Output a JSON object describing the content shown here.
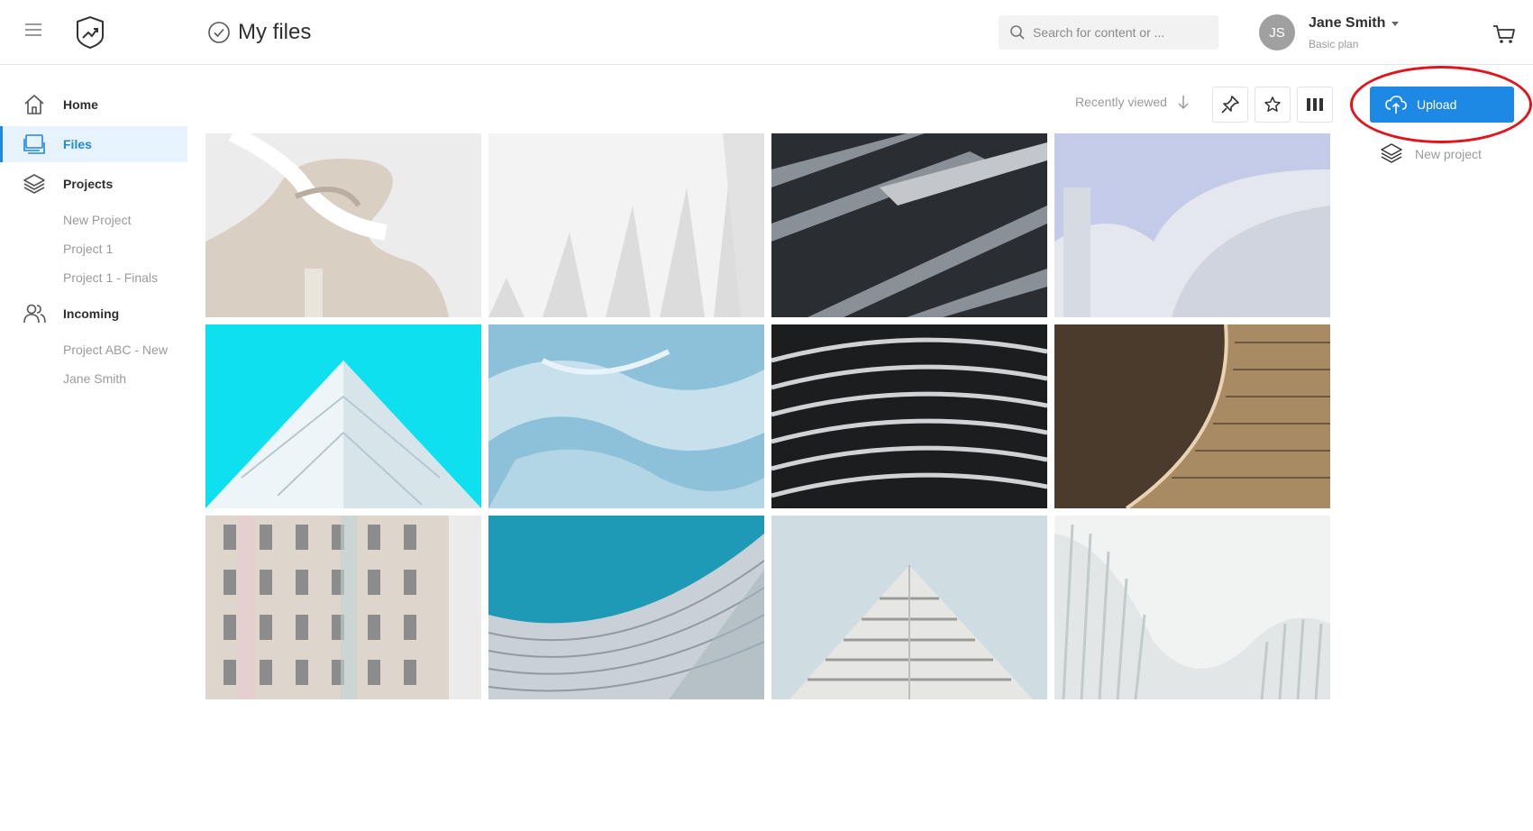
{
  "header": {
    "title": "My files",
    "search_placeholder": "Search for content or ...",
    "user": {
      "initials": "JS",
      "name": "Jane Smith",
      "plan": "Basic plan"
    }
  },
  "sidebar": {
    "home_label": "Home",
    "files_label": "Files",
    "projects_label": "Projects",
    "projects_items": [
      "New Project",
      "Project 1",
      "Project 1 - Finals"
    ],
    "incoming_label": "Incoming",
    "incoming_items": [
      "Project ABC - New",
      "Jane Smith"
    ]
  },
  "toolbar": {
    "sort_label": "Recently viewed",
    "icons": [
      "pin-icon",
      "star-icon",
      "columns-view-icon"
    ]
  },
  "actions": {
    "upload_label": "Upload",
    "new_project_label": "New project"
  },
  "grid": {
    "images": [
      "white-curved-balconies",
      "white-fin-facade",
      "dark-angled-facade",
      "silver-curved-building-blue-sky",
      "white-pyramid-cyan-sky",
      "blue-water-sky-reflection",
      "black-striped-curved-facade",
      "brown-slatted-curve",
      "pastel-window-facade",
      "woven-facade-teal-sky",
      "stepped-white-tower-pale-sky",
      "white-ribbed-structure"
    ]
  },
  "colors": {
    "accent": "#1e88e5",
    "highlight": "#e2141b",
    "muted": "#9a9a9a"
  }
}
